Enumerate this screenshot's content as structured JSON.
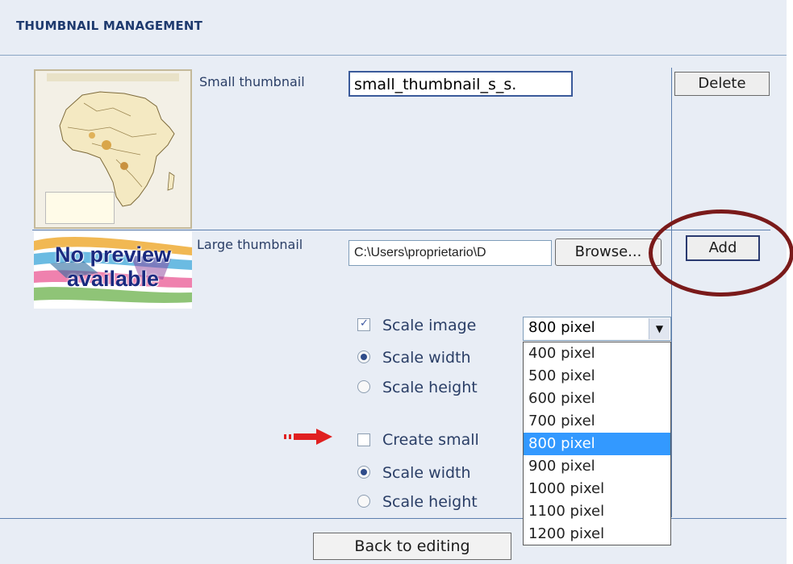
{
  "header": {
    "title": "THUMBNAIL MANAGEMENT"
  },
  "small_thumbnail": {
    "label": "Small thumbnail",
    "filename": "small_thumbnail_s_s.",
    "delete_label": "Delete",
    "preview_icon": "map-of-africa-icon"
  },
  "large_thumbnail": {
    "label": "Large thumbnail",
    "file_path": "C:\\Users\\proprietario\\D",
    "browse_label": "Browse...",
    "add_label": "Add",
    "no_preview_line1": "No preview",
    "no_preview_line2": "available"
  },
  "scale_image": {
    "label": "Scale image",
    "checked": true,
    "selected": "800 pixel",
    "options": [
      "400 pixel",
      "500 pixel",
      "600 pixel",
      "700 pixel",
      "800 pixel",
      "900 pixel",
      "1000 pixel",
      "1100 pixel",
      "1200 pixel"
    ],
    "scale_width_label": "Scale width",
    "scale_height_label": "Scale height",
    "mode": "width"
  },
  "create_small": {
    "label": "Create small",
    "checked": false,
    "scale_width_label": "Scale width",
    "scale_height_label": "Scale height",
    "mode": "width"
  },
  "footer": {
    "back_label": "Back to editing"
  },
  "annotations": {
    "arrow_icon": "red-arrow-icon",
    "highlight": "red-circle-highlight"
  },
  "colors": {
    "panel": "#e8edf5",
    "border": "#5d7fae",
    "selection": "#3399ff",
    "annotation_circle": "#7a1a1a",
    "annotation_arrow": "#e02020"
  }
}
